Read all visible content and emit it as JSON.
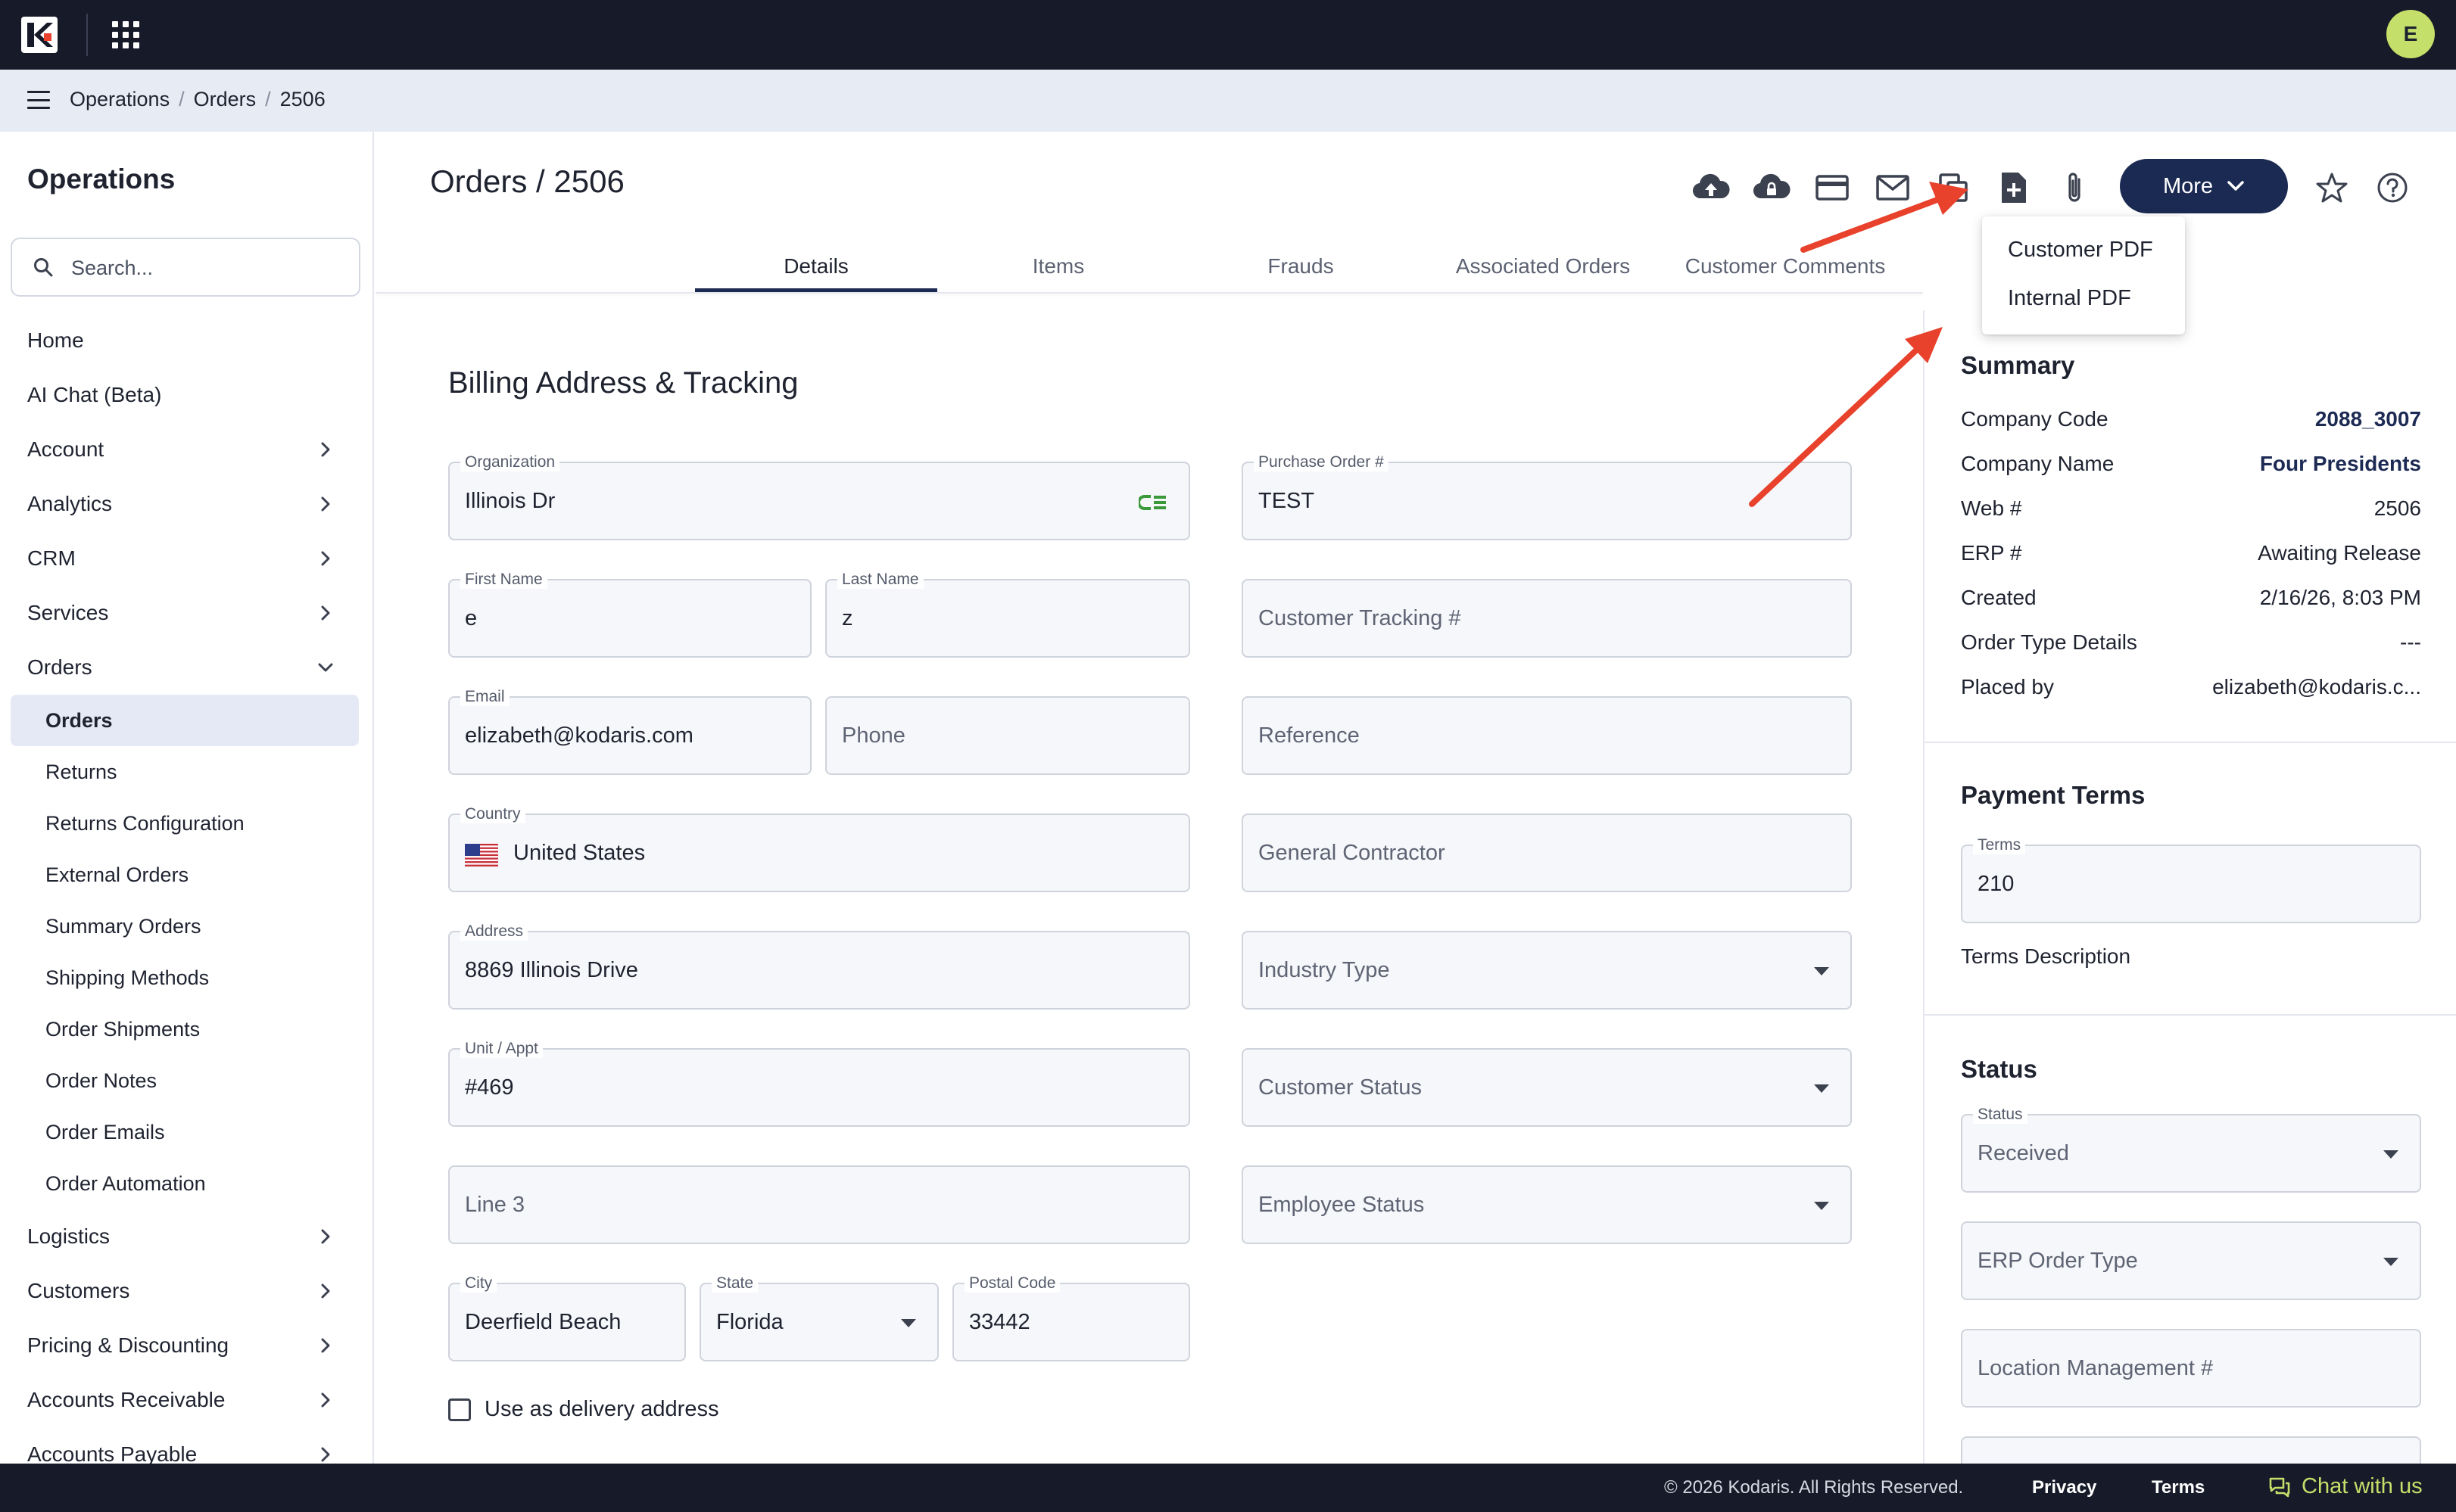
{
  "topbar": {
    "avatar_initial": "E"
  },
  "breadcrumb": [
    "Operations",
    "Orders",
    "2506"
  ],
  "sidebar": {
    "title": "Operations",
    "search_placeholder": "Search...",
    "items": [
      {
        "label": "Home",
        "expandable": false
      },
      {
        "label": "AI Chat (Beta)",
        "expandable": false
      },
      {
        "label": "Account",
        "expandable": true
      },
      {
        "label": "Analytics",
        "expandable": true
      },
      {
        "label": "CRM",
        "expandable": true
      },
      {
        "label": "Services",
        "expandable": true
      },
      {
        "label": "Orders",
        "expandable": true,
        "expanded": true
      },
      {
        "label": "Orders",
        "sub": true,
        "active": true
      },
      {
        "label": "Returns",
        "sub": true
      },
      {
        "label": "Returns Configuration",
        "sub": true
      },
      {
        "label": "External Orders",
        "sub": true
      },
      {
        "label": "Summary Orders",
        "sub": true
      },
      {
        "label": "Shipping Methods",
        "sub": true
      },
      {
        "label": "Order Shipments",
        "sub": true
      },
      {
        "label": "Order Notes",
        "sub": true
      },
      {
        "label": "Order Emails",
        "sub": true
      },
      {
        "label": "Order Automation",
        "sub": true
      },
      {
        "label": "Logistics",
        "expandable": true
      },
      {
        "label": "Customers",
        "expandable": true
      },
      {
        "label": "Pricing & Discounting",
        "expandable": true
      },
      {
        "label": "Accounts Receivable",
        "expandable": true
      },
      {
        "label": "Accounts Payable",
        "expandable": true
      }
    ]
  },
  "header": {
    "title": "Orders / 2506",
    "more_label": "More",
    "icons": [
      "cloud-upload-icon",
      "cloud-lock-icon",
      "credit-card-icon",
      "mail-icon",
      "copy-icon",
      "add-document-icon",
      "attachment-icon",
      "star-icon",
      "help-icon"
    ]
  },
  "tabs": [
    "Details",
    "Items",
    "Frauds",
    "Associated Orders",
    "Customer Comments"
  ],
  "more_menu": [
    "Customer PDF",
    "Internal PDF"
  ],
  "billing": {
    "section_title": "Billing Address & Tracking",
    "organization": {
      "label": "Organization",
      "value": "Illinois Dr"
    },
    "first_name": {
      "label": "First Name",
      "value": "e"
    },
    "last_name": {
      "label": "Last Name",
      "value": "z"
    },
    "email": {
      "label": "Email",
      "value": "elizabeth@kodaris.com"
    },
    "phone": {
      "placeholder": "Phone"
    },
    "country": {
      "label": "Country",
      "value": "United States"
    },
    "address": {
      "label": "Address",
      "value": "8869 Illinois Drive"
    },
    "unit": {
      "label": "Unit / Appt",
      "value": "#469"
    },
    "line3": {
      "placeholder": "Line 3"
    },
    "city": {
      "label": "City",
      "value": "Deerfield Beach"
    },
    "state": {
      "label": "State",
      "value": "Florida"
    },
    "postal": {
      "label": "Postal Code",
      "value": "33442"
    },
    "use_as_delivery": "Use as delivery address",
    "purchase_order": {
      "label": "Purchase Order #",
      "value": "TEST"
    },
    "customer_tracking": {
      "placeholder": "Customer Tracking #"
    },
    "reference": {
      "placeholder": "Reference"
    },
    "general_contractor": {
      "placeholder": "General Contractor"
    },
    "industry_type": {
      "placeholder": "Industry Type"
    },
    "customer_status": {
      "placeholder": "Customer Status"
    },
    "employee_status": {
      "placeholder": "Employee Status"
    }
  },
  "summary": {
    "title": "Summary",
    "rows": [
      {
        "key": "Company Code",
        "value": "2088_3007",
        "link": true
      },
      {
        "key": "Company Name",
        "value": "Four Presidents",
        "link": true
      },
      {
        "key": "Web #",
        "value": "2506"
      },
      {
        "key": "ERP #",
        "value": "Awaiting Release"
      },
      {
        "key": "Created",
        "value": "2/16/26, 8:03 PM"
      },
      {
        "key": "Order Type Details",
        "value": "---"
      },
      {
        "key": "Placed by",
        "value": "elizabeth@kodaris.c..."
      }
    ]
  },
  "payment_terms": {
    "title": "Payment Terms",
    "terms_label": "Terms",
    "terms_value": "210",
    "description_label": "Terms Description"
  },
  "status_panel": {
    "title": "Status",
    "status_label": "Status",
    "status_value": "Received",
    "erp_order_type_placeholder": "ERP Order Type",
    "location_placeholder": "Location Management #"
  },
  "footer": {
    "copyright": "© 2026 Kodaris. All Rights Reserved.",
    "privacy": "Privacy",
    "terms": "Terms",
    "chat": "Chat with us"
  },
  "colors": {
    "topbar": "#171b29",
    "accent": "#1b2a52",
    "avatar": "#c4e06a",
    "annotation_arrow": "#e8412c"
  }
}
